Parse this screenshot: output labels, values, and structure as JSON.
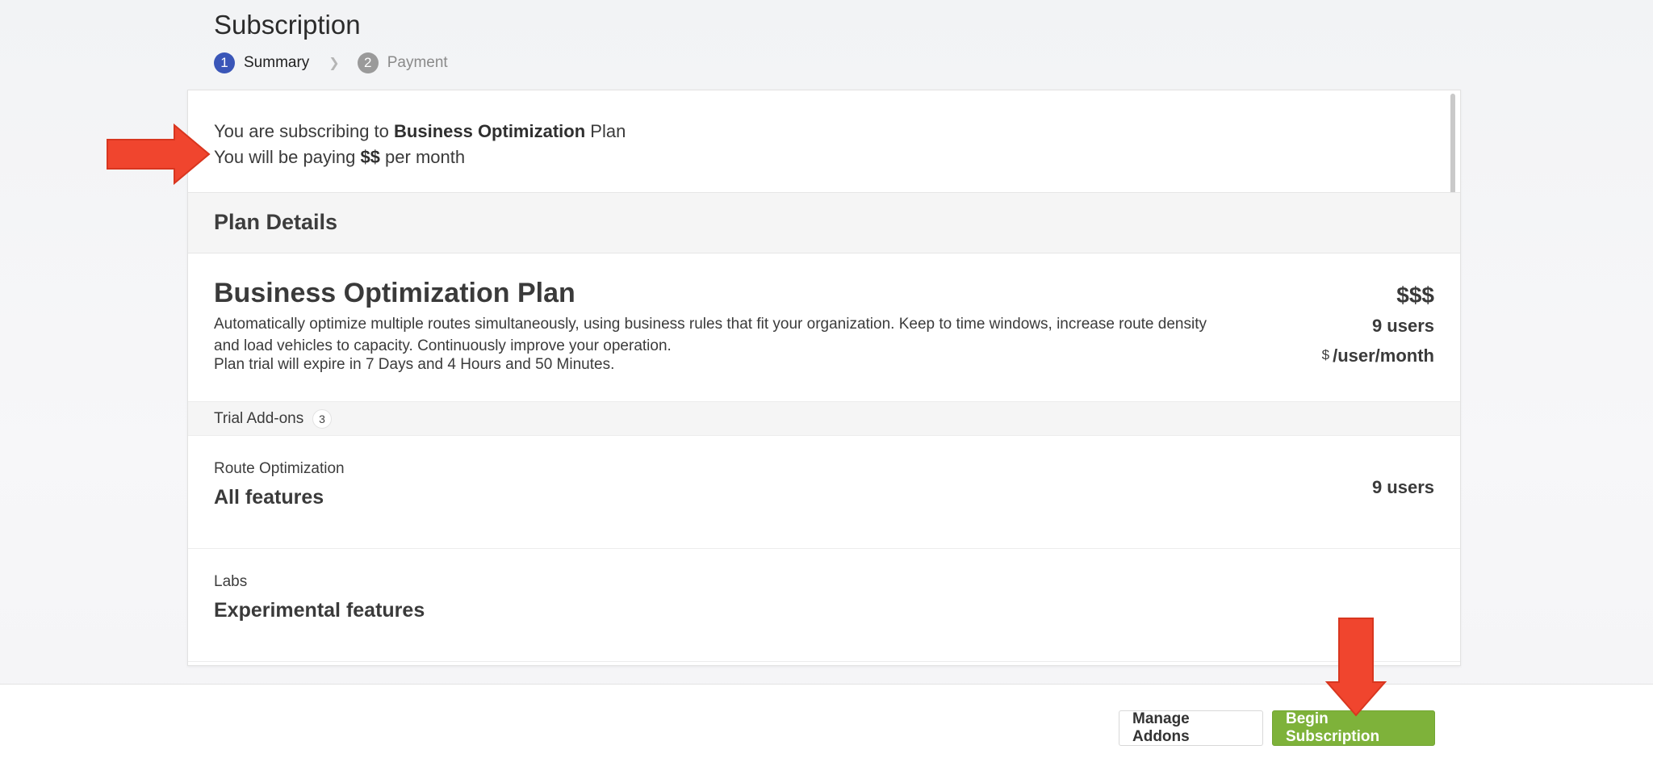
{
  "header": {
    "title": "Subscription",
    "steps": [
      {
        "number": "1",
        "label": "Summary",
        "state": "active"
      },
      {
        "number": "2",
        "label": "Payment",
        "state": "inactive"
      }
    ],
    "step_separator_icon": "chevron-right-icon"
  },
  "summary": {
    "line1_prefix": "You are subscribing to",
    "line1_plan": "Business Optimization",
    "line1_suffix": "Plan",
    "line2_prefix": "You will be paying",
    "line2_amount": "$$",
    "line2_suffix": "per month"
  },
  "plan_details": {
    "header": "Plan Details",
    "name": "Business Optimization Plan",
    "description": "Automatically optimize multiple routes simultaneously, using business rules that fit your organization. Keep to time windows, increase route density and load vehicles to capacity. Continuously improve your operation.",
    "trial_expire": "Plan trial will expire in 7 Days and 4 Hours and 50 Minutes.",
    "price_total": "$$$",
    "users": "9 users",
    "price_currency": "$",
    "price_unit": "/user/month"
  },
  "addons": {
    "label": "Trial Add-ons",
    "count": "3",
    "items": [
      {
        "category": "Route Optimization",
        "name": "All features",
        "quantity": "9 users"
      },
      {
        "category": "Labs",
        "name": "Experimental features",
        "quantity": ""
      }
    ]
  },
  "footer": {
    "manage_label": "Manage Addons",
    "begin_label": "Begin Subscription"
  },
  "colors": {
    "accent_blue": "#3a56b8",
    "primary_green": "#7eb23a",
    "annotation_red": "#f0452e"
  }
}
